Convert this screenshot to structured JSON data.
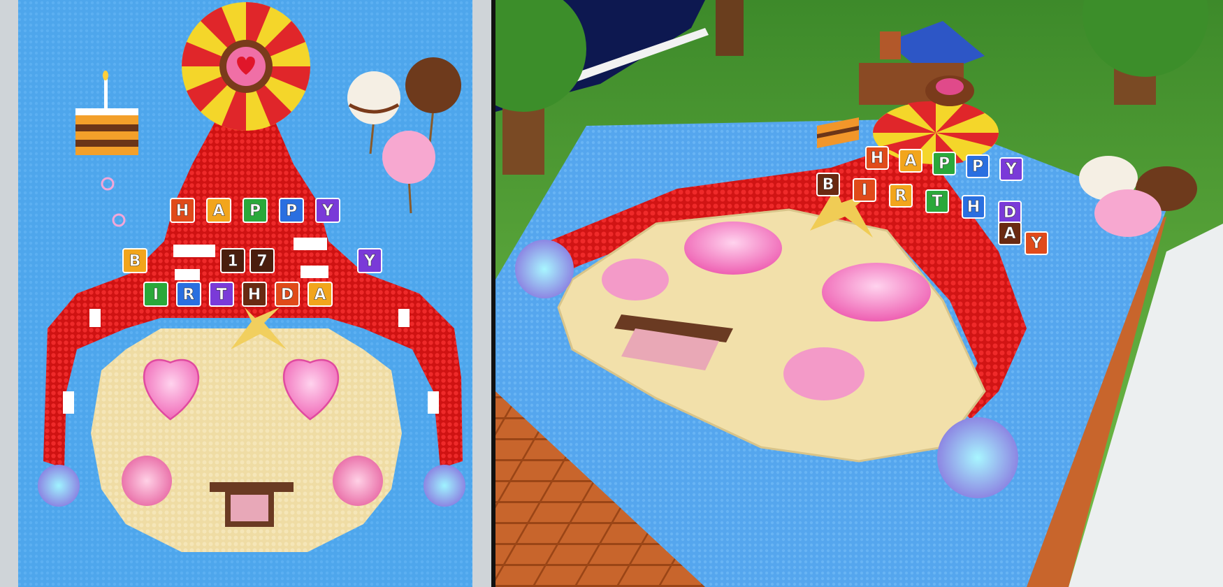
{
  "view_left": {
    "name": "top-down view",
    "colors": {
      "water": "#4aa3ea",
      "hat": "#e41e1e",
      "hat_white": "#ffffff",
      "face": "#f0dfa8",
      "cheeks": "#f49ad0",
      "border": "#d9dde0"
    },
    "banner_lines": [
      {
        "letters": [
          "H",
          "A",
          "P",
          "P",
          "Y"
        ]
      },
      {
        "letters": [
          "B",
          "1",
          "7",
          "Y"
        ]
      },
      {
        "letters": [
          "I",
          "R",
          "T",
          "H",
          "D",
          "A"
        ]
      }
    ]
  },
  "view_right": {
    "name": "perspective view",
    "colors": {
      "grass": "#5cae3a",
      "water": "#5aaaf0",
      "deck": "#c8652c",
      "path": "#eef0f0"
    },
    "banner_letters": [
      "H",
      "A",
      "P",
      "P",
      "Y",
      "B",
      "I",
      "R",
      "T",
      "H",
      "D",
      "A",
      "Y"
    ]
  }
}
